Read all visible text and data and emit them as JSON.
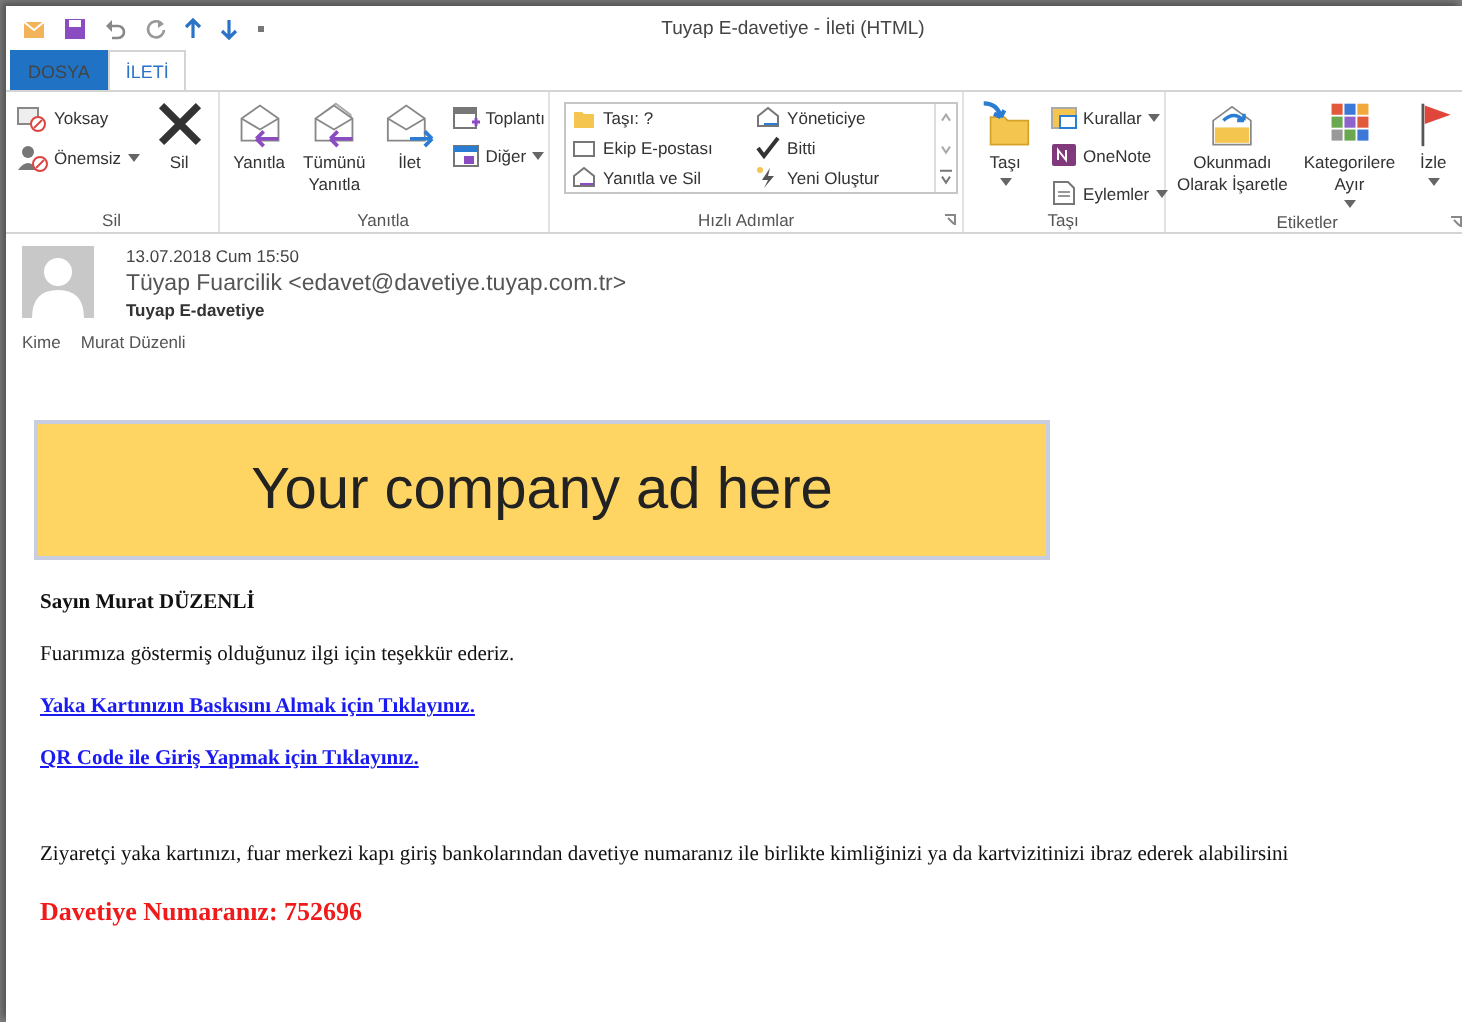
{
  "window": {
    "title": "Tuyap E-davetiye - İleti (HTML)"
  },
  "tabs": [
    {
      "label": "DOSYA",
      "kind": "backstage",
      "selected": false
    },
    {
      "label": "İLETİ",
      "kind": "tab",
      "selected": true
    }
  ],
  "ribbon": {
    "groups": [
      {
        "label": "Sil",
        "kind": "buttons",
        "launcher": false,
        "items": [
          {
            "label": "Yoksay",
            "kind": "small",
            "dropdown": false
          },
          {
            "label": "Önemsiz",
            "kind": "small",
            "dropdown": true
          },
          {
            "label": "Sil",
            "kind": "large",
            "dropdown": false
          }
        ]
      },
      {
        "label": "Yanıtla",
        "kind": "buttons",
        "launcher": false,
        "items": [
          {
            "label": "Yanıtla",
            "kind": "large",
            "dropdown": false
          },
          {
            "label": "Tümünü\nYanıtla",
            "kind": "large",
            "dropdown": false
          },
          {
            "label": "İlet",
            "kind": "large",
            "dropdown": false
          },
          {
            "label": "Toplantı",
            "kind": "small",
            "dropdown": false
          },
          {
            "label": "Diğer",
            "kind": "small",
            "dropdown": true
          }
        ]
      },
      {
        "label": "Hızlı Adımlar",
        "kind": "gallery",
        "launcher": true,
        "items": [
          {
            "label": "Taşı: ?"
          },
          {
            "label": "Ekip E-postası"
          },
          {
            "label": "Yanıtla ve Sil"
          },
          {
            "label": "Yöneticiye"
          },
          {
            "label": "Bitti"
          },
          {
            "label": "Yeni Oluştur"
          }
        ]
      },
      {
        "label": "Taşı",
        "kind": "buttons",
        "launcher": false,
        "items": [
          {
            "label": "Taşı",
            "kind": "large",
            "dropdown": true
          },
          {
            "label": "Kurallar",
            "kind": "small",
            "dropdown": true
          },
          {
            "label": "OneNote",
            "kind": "small",
            "dropdown": false
          },
          {
            "label": "Eylemler",
            "kind": "small",
            "dropdown": true
          }
        ]
      },
      {
        "label": "Etiketler",
        "kind": "buttons",
        "launcher": true,
        "items": [
          {
            "label": "Okunmadı\nOlarak İşaretle",
            "kind": "large",
            "dropdown": false
          },
          {
            "label": "Kategorilere\nAyır",
            "kind": "large",
            "dropdown": true
          },
          {
            "label": "İzle",
            "kind": "large",
            "dropdown": true
          }
        ]
      }
    ]
  },
  "header": {
    "date": "13.07.2018 Cum 15:50",
    "sender": "Tüyap Fuarcilik <edavet@davetiye.tuyap.com.tr>",
    "subject": "Tuyap E-davetiye",
    "to_label": "Kime",
    "to": "Murat Düzenli"
  },
  "body": {
    "ad": "Your company ad here",
    "greeting": "Sayın Murat DÜZENLİ",
    "intro": "Fuarımıza göstermiş olduğunuz ilgi için teşekkür ederiz.",
    "links": [
      "Yaka Kartınızın Baskısını Almak için Tıklayınız.",
      "QR Code ile Giriş Yapmak için Tıklayınız."
    ],
    "notice": "Ziyaretçi yaka kartınızı, fuar merkezi kapı giriş bankolarından davetiye numaranız ile birlikte kimliğinizi ya da kartvizitinizi ibraz ederek alabilirsini",
    "invitation": "Davetiye Numaranız: 752696"
  }
}
